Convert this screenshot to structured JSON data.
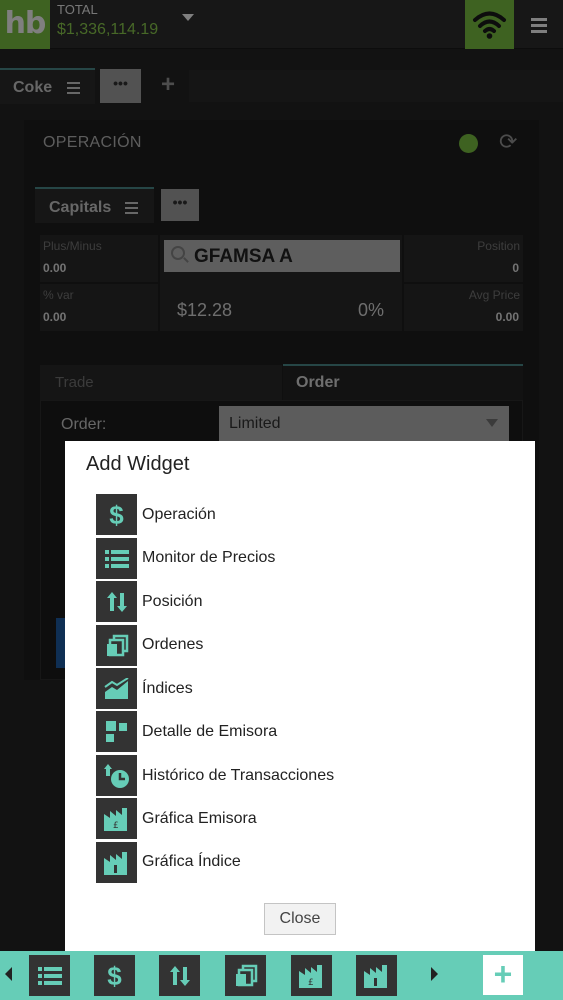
{
  "app": {
    "logo": "hb",
    "total_label": "TOTAL",
    "total_value": "$1,336,114.19",
    "accent": "#7cc442",
    "teal": "#66cdb7"
  },
  "tabs": {
    "active": "Coke",
    "more": "•••",
    "add": "+"
  },
  "widget": {
    "title": "OPERACIÓN",
    "status_color": "#7cc442",
    "subtab": "Capitals",
    "subtab_more": "•••",
    "plus_minus_label": "Plus/Minus",
    "plus_minus_value": "0.00",
    "var_label": "% var",
    "var_value": "0.00",
    "ticker": "GFAMSA A",
    "price": "$12.28",
    "change_pct": "0%",
    "position_label": "Position",
    "position_value": "0",
    "avg_price_label": "Avg Price",
    "avg_price_value": "0.00",
    "trade_tab": "Trade",
    "order_tab": "Order",
    "order_label": "Order:",
    "order_type": "Limited"
  },
  "modal": {
    "title": "Add Widget",
    "items": [
      {
        "label": "Operación",
        "icon": "dollar-icon"
      },
      {
        "label": "Monitor de Precios",
        "icon": "list-icon"
      },
      {
        "label": "Posición",
        "icon": "sort-arrows-icon"
      },
      {
        "label": "Ordenes",
        "icon": "documents-icon"
      },
      {
        "label": "Índices",
        "icon": "area-chart-icon"
      },
      {
        "label": "Detalle de Emisora",
        "icon": "tiles-icon"
      },
      {
        "label": "Histórico de Transacciones",
        "icon": "history-clock-icon"
      },
      {
        "label": "Gráfica Emisora",
        "icon": "factory-chart-icon"
      },
      {
        "label": "Gráfica Índice",
        "icon": "factory-index-icon"
      }
    ],
    "close_label": "Close"
  },
  "bottom_bar": {
    "items": [
      "list-icon",
      "dollar-icon",
      "sort-arrows-icon",
      "documents-icon",
      "factory-chart-icon",
      "factory-index-icon"
    ],
    "add": "+"
  }
}
